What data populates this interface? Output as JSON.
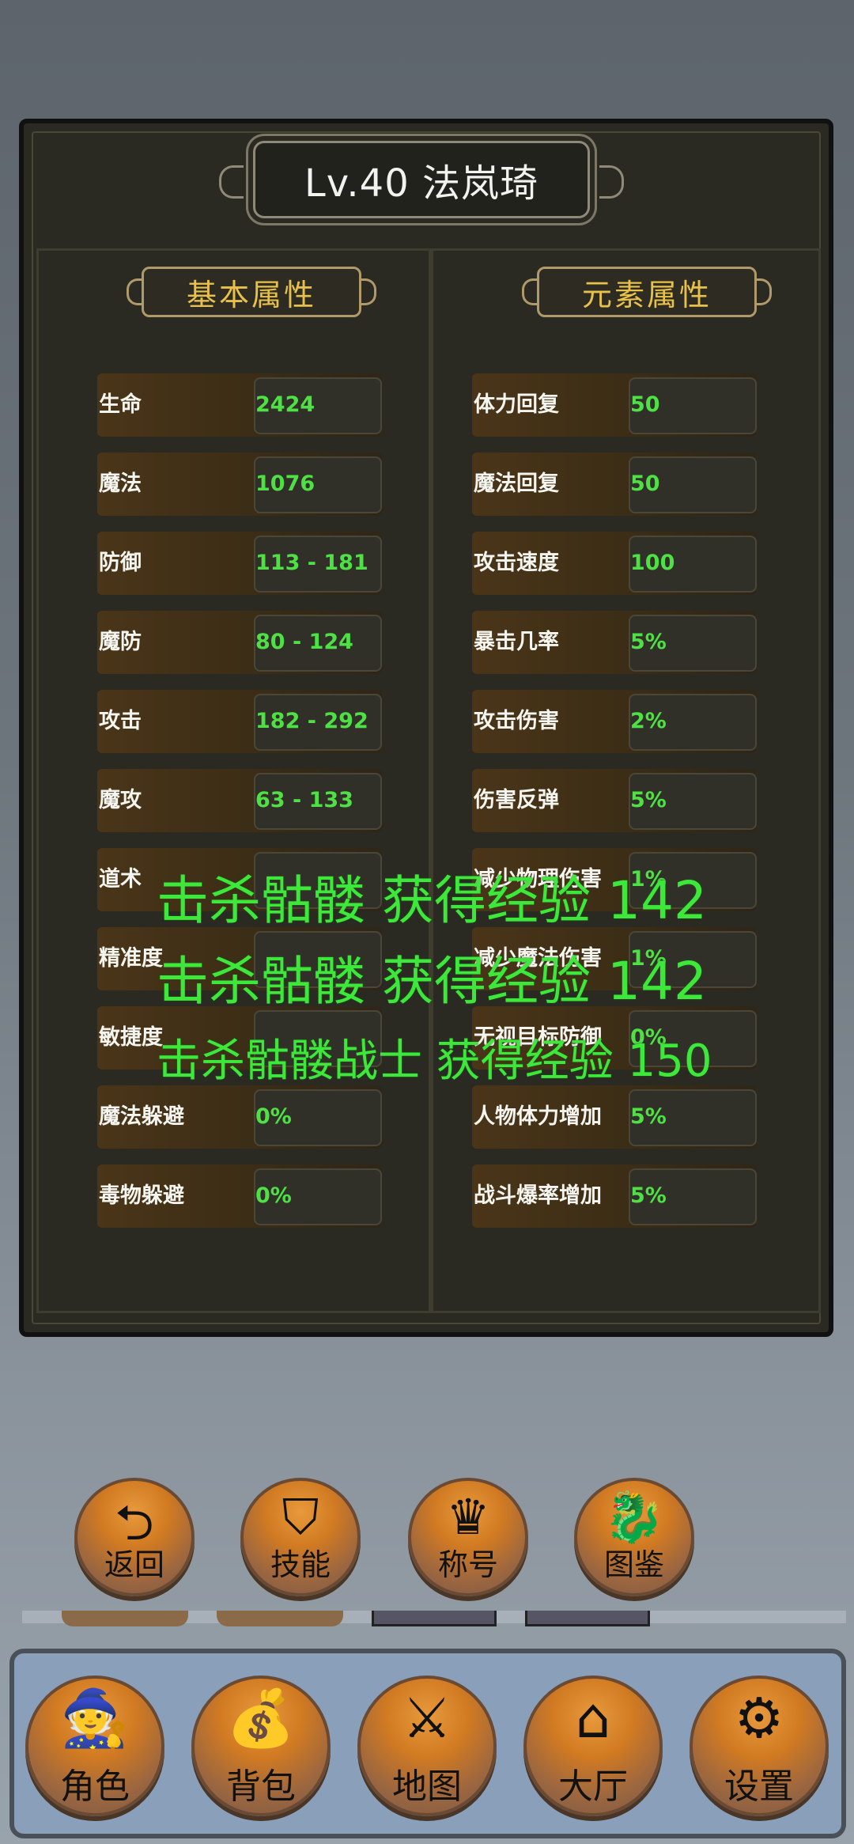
{
  "title": "Lv.40 法岚琦",
  "basic_header": "基本属性",
  "element_header": "元素属性",
  "basic_stats": [
    {
      "label": "生命",
      "value": "2424"
    },
    {
      "label": "魔法",
      "value": "1076"
    },
    {
      "label": "防御",
      "value": "113 - 181"
    },
    {
      "label": "魔防",
      "value": "80 - 124"
    },
    {
      "label": "攻击",
      "value": "182 - 292"
    },
    {
      "label": "魔攻",
      "value": "63 - 133"
    },
    {
      "label": "道术",
      "value": ""
    },
    {
      "label": "精准度",
      "value": ""
    },
    {
      "label": "敏捷度",
      "value": ""
    },
    {
      "label": "魔法躲避",
      "value": "0%"
    },
    {
      "label": "毒物躲避",
      "value": "0%"
    }
  ],
  "element_stats": [
    {
      "label": "体力回复",
      "value": "50"
    },
    {
      "label": "魔法回复",
      "value": "50"
    },
    {
      "label": "攻击速度",
      "value": "100"
    },
    {
      "label": "暴击几率",
      "value": "5%"
    },
    {
      "label": "攻击伤害",
      "value": "2%"
    },
    {
      "label": "伤害反弹",
      "value": "5%"
    },
    {
      "label": "减少物理伤害",
      "value": "1%"
    },
    {
      "label": "减少魔法伤害",
      "value": "1%"
    },
    {
      "label": "无视目标防御",
      "value": "0%"
    },
    {
      "label": "人物体力增加",
      "value": "5%"
    },
    {
      "label": "战斗爆率增加",
      "value": "5%"
    }
  ],
  "exp_messages": [
    "击杀骷髅 获得经验 142",
    "击杀骷髅 获得经验 142",
    "击杀骷髅战士 获得经验 150"
  ],
  "sub_buttons": [
    {
      "label": "返回",
      "icon": "return-arrow-icon",
      "glyph": "⮌"
    },
    {
      "label": "技能",
      "icon": "skill-emblem-icon",
      "glyph": "⛉"
    },
    {
      "label": "称号",
      "icon": "crown-icon",
      "glyph": "♛"
    },
    {
      "label": "图鉴",
      "icon": "dragon-icon",
      "glyph": "🐉"
    }
  ],
  "nav_buttons": [
    {
      "label": "角色",
      "icon": "wizard-icon",
      "glyph": "🧙"
    },
    {
      "label": "背包",
      "icon": "bag-icon",
      "glyph": "💰"
    },
    {
      "label": "地图",
      "icon": "crossed-swords-icon",
      "glyph": "⚔"
    },
    {
      "label": "大厅",
      "icon": "house-icon",
      "glyph": "⌂"
    },
    {
      "label": "设置",
      "icon": "gears-icon",
      "glyph": "⚙"
    }
  ],
  "colors": {
    "value_green": "#4ee044",
    "header_gold": "#e8c14a",
    "exp_green": "#3ee83a",
    "button_orange": "#d17a22"
  }
}
